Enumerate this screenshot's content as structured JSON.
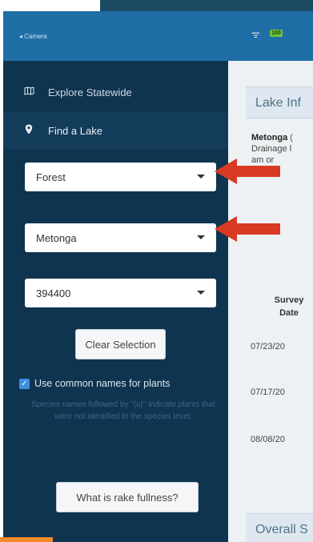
{
  "status": {
    "back_label": "◂ Camera",
    "battery": "100"
  },
  "sidebar": {
    "nav": [
      {
        "label": "Explore Statewide",
        "icon": "map-icon"
      },
      {
        "label": "Find a Lake",
        "icon": "map-pin-icon"
      }
    ],
    "selects": [
      {
        "value": "Forest"
      },
      {
        "value": "Metonga"
      },
      {
        "value": "394400"
      }
    ],
    "clear_button": "Clear Selection",
    "checkbox_label": "Use common names for plants",
    "checkbox_checked": true,
    "note": "Species names followed by \"(u)\" indicate plants that were not identified to the species level.",
    "rake_button": "What is rake fullness?"
  },
  "content": {
    "section_title": "Lake Inf",
    "lake_name": "Metonga",
    "lake_name_suffix": "(",
    "drainage": "Drainage l",
    "drainage2": "am or",
    "col_header": "Survey Date",
    "dates": [
      "07/23/20",
      "07/17/20",
      "08/08/20"
    ],
    "overall_title": "Overall S"
  },
  "colors": {
    "sidebar_bg": "#0f3450",
    "status_bg": "#1f6fa6",
    "arrow": "#d93a22",
    "accent_checkbox": "#3d8ee0"
  }
}
